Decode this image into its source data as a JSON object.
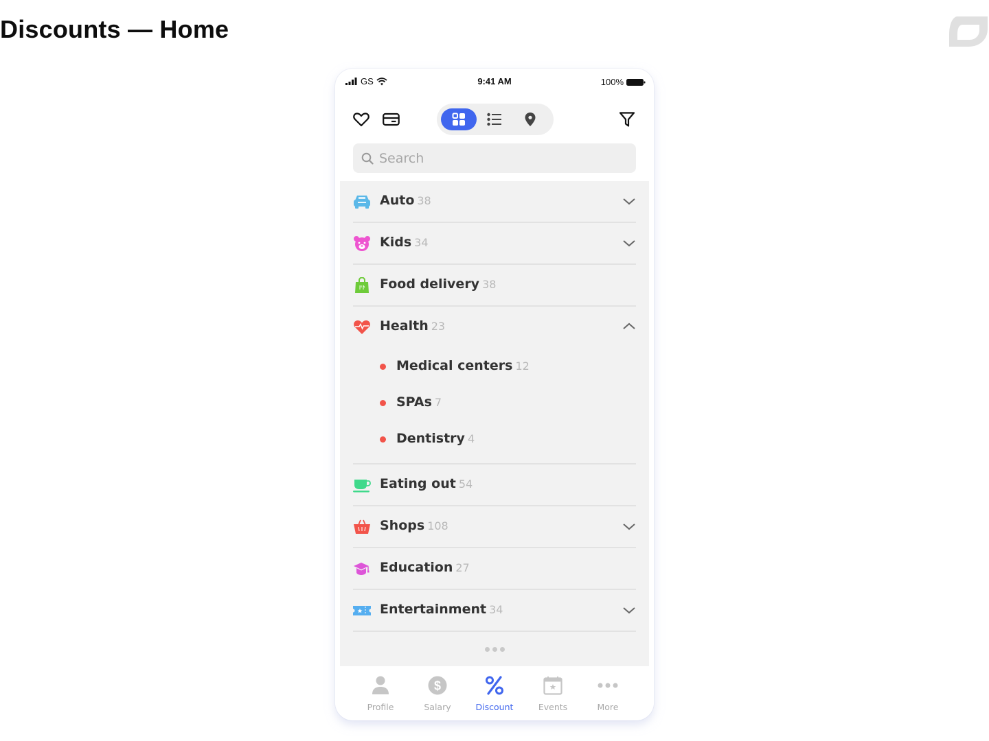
{
  "page": {
    "title": "Discounts — Home",
    "brand_logo": "leaf-logo-icon"
  },
  "status_bar": {
    "signal_icon": "signal-bars-icon",
    "carrier": "GS",
    "wifi_icon": "wifi-icon",
    "time": "9:41 AM",
    "battery_percent": "100%",
    "battery_icon": "battery-full-icon"
  },
  "toolbar": {
    "favorites_icon": "heart-icon",
    "card_icon": "card-icon",
    "view_modes": [
      {
        "name": "grid",
        "icon": "grid-icon",
        "active": true
      },
      {
        "name": "list",
        "icon": "list-icon",
        "active": false
      },
      {
        "name": "map",
        "icon": "map-pin-icon",
        "active": false
      }
    ],
    "filter_icon": "filter-icon",
    "colors": {
      "active_view": "#4066ee"
    }
  },
  "search": {
    "placeholder": "Search",
    "value": ""
  },
  "categories": [
    {
      "label": "Auto",
      "count": "38",
      "icon": "car-icon",
      "color": "#5bb8e8",
      "chevron": "down"
    },
    {
      "label": "Kids",
      "count": "34",
      "icon": "teddy-bear-icon",
      "color": "#ee55d0",
      "chevron": "down"
    },
    {
      "label": "Food delivery",
      "count": "38",
      "icon": "shopping-bag-icon",
      "color": "#6ecb3a",
      "chevron": null
    },
    {
      "label": "Health",
      "count": "23",
      "icon": "heart-pulse-icon",
      "color": "#f2544a",
      "chevron": "up",
      "subcategories": [
        {
          "label": "Medical centers",
          "count": "12"
        },
        {
          "label": "SPAs",
          "count": "7"
        },
        {
          "label": "Dentistry",
          "count": "4"
        }
      ]
    },
    {
      "label": "Eating out",
      "count": "54",
      "icon": "coffee-cup-icon",
      "color": "#3fd98b",
      "chevron": null
    },
    {
      "label": "Shops",
      "count": "108",
      "icon": "basket-icon",
      "color": "#f2544a",
      "chevron": "down"
    },
    {
      "label": "Education",
      "count": "27",
      "icon": "graduation-cap-icon",
      "color": "#dd55d8",
      "chevron": null
    },
    {
      "label": "Entertainment",
      "count": "34",
      "icon": "ticket-icon",
      "color": "#55aef0",
      "chevron": "down"
    }
  ],
  "list_more_icon": "ellipsis-icon",
  "tab_bar": {
    "tabs": [
      {
        "label": "Profile",
        "icon": "person-icon",
        "active": false
      },
      {
        "label": "Salary",
        "icon": "dollar-coin-icon",
        "active": false
      },
      {
        "label": "Discount",
        "icon": "percent-icon",
        "active": true
      },
      {
        "label": "Events",
        "icon": "calendar-star-icon",
        "active": false
      },
      {
        "label": "More",
        "icon": "more-dots-icon",
        "active": false
      }
    ],
    "colors": {
      "active": "#4066ee",
      "inactive": "#a8a8a8"
    }
  }
}
